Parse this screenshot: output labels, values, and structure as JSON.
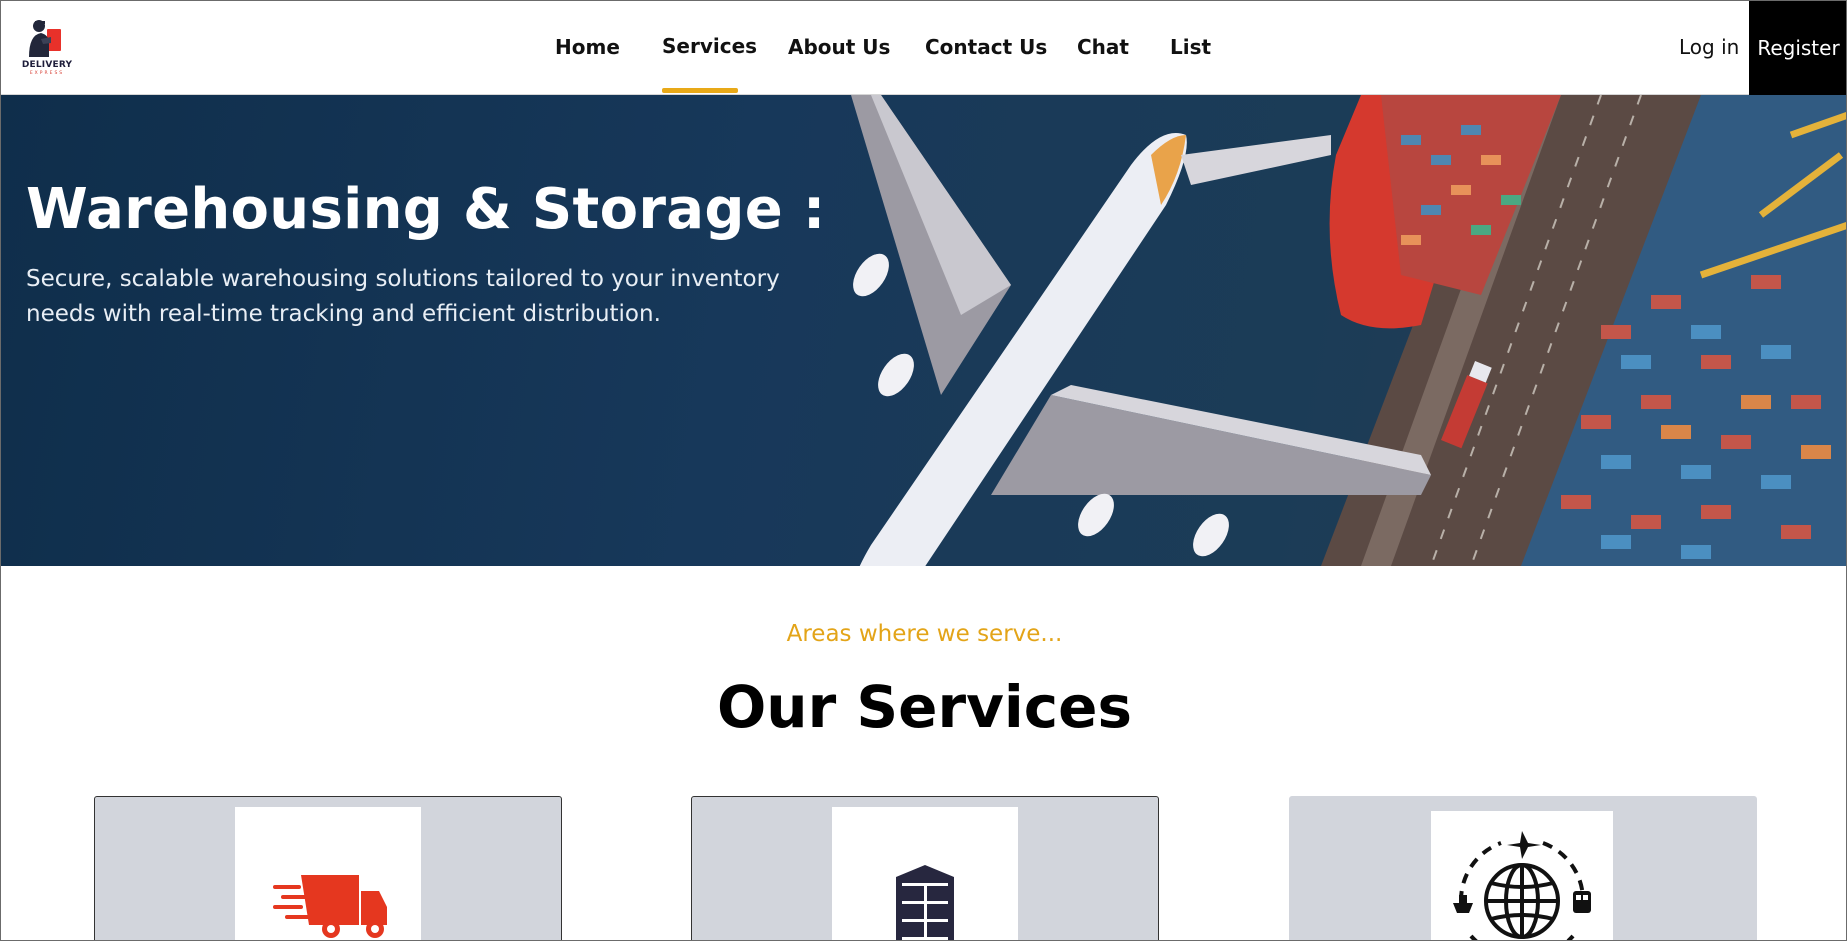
{
  "brand": {
    "name": "DELIVERY",
    "tagline": "EXPRESS",
    "accent": "#e8a918"
  },
  "nav": {
    "items": [
      {
        "label": "Home"
      },
      {
        "label": "Services",
        "active": true
      },
      {
        "label": "About Us"
      },
      {
        "label": "Contact Us"
      },
      {
        "label": "Chat"
      },
      {
        "label": "List"
      }
    ],
    "login": "Log in",
    "register": "Register"
  },
  "hero": {
    "title": "Warehousing & Storage :",
    "description": "Secure, scalable warehousing solutions tailored to your inventory needs with real-time tracking and efficient distribution."
  },
  "services": {
    "eyebrow": "Areas where we serve...",
    "title": "Our Services",
    "cards": [
      {
        "icon": "fast-delivery-truck-icon",
        "icon_color": "#e5371f"
      },
      {
        "icon": "warehouse-shelves-icon",
        "icon_color": "#27273f"
      },
      {
        "icon": "global-logistics-icon",
        "icon_color": "#111111"
      }
    ]
  }
}
